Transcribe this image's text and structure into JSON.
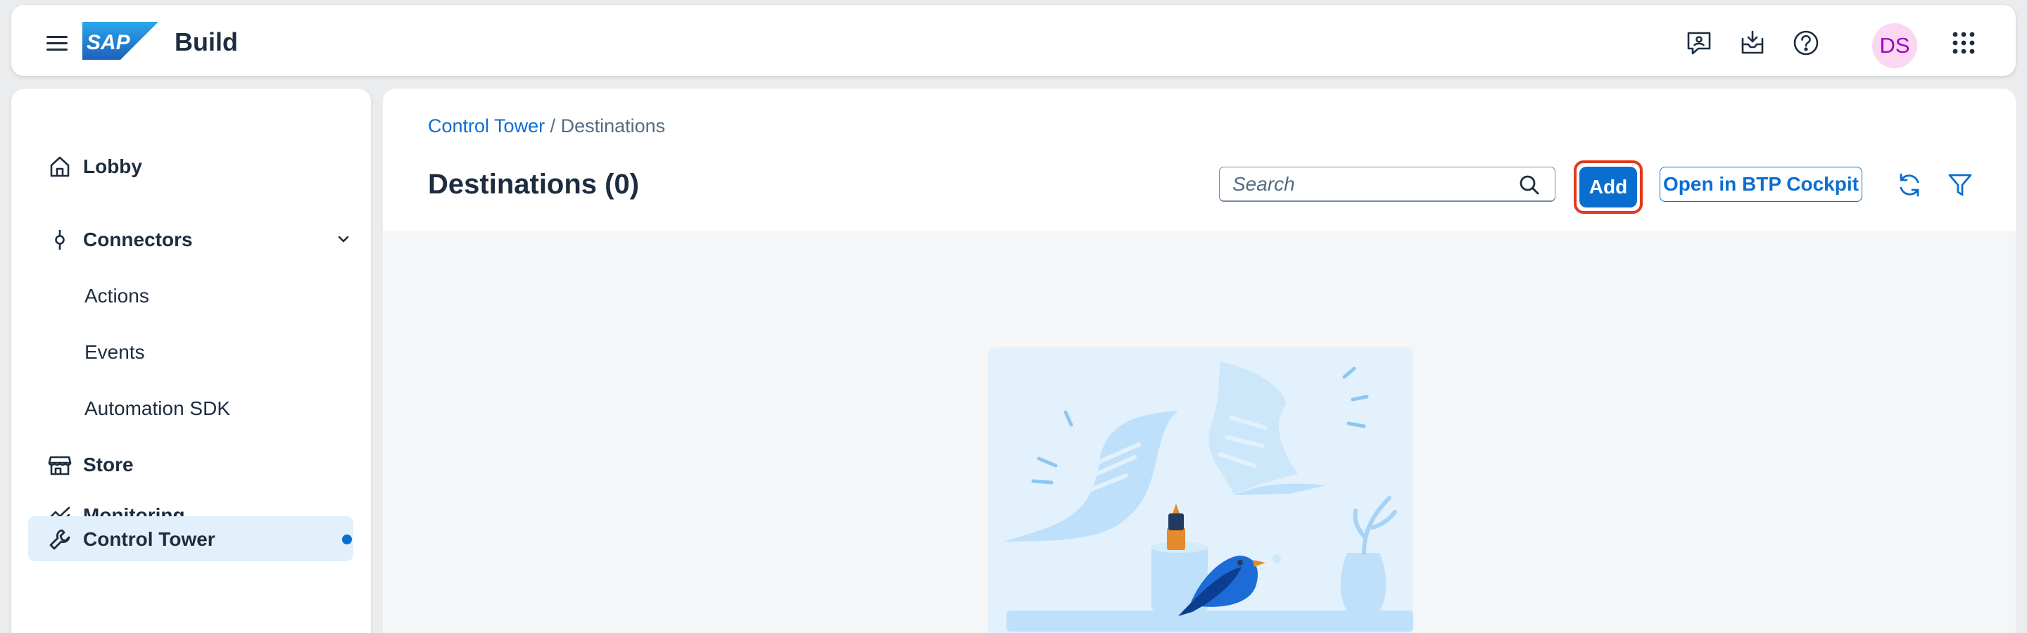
{
  "shell": {
    "logo_text": "SAP",
    "product_name": "Build",
    "avatar_initials": "DS",
    "icons": [
      "menu-icon",
      "feedback-icon",
      "notifications-icon",
      "help-icon",
      "avatar",
      "product-switch-icon"
    ]
  },
  "sidebar": {
    "items": [
      {
        "label": "Lobby",
        "icon": "home-icon"
      },
      {
        "label": "Connectors",
        "icon": "connector-icon",
        "expanded": true
      },
      {
        "label": "Actions"
      },
      {
        "label": "Events"
      },
      {
        "label": "Automation SDK"
      },
      {
        "label": "Store",
        "icon": "store-icon"
      },
      {
        "label": "Monitoring",
        "icon": "monitoring-icon"
      },
      {
        "label": "Control Tower",
        "icon": "wrench-icon",
        "selected": true
      }
    ]
  },
  "main": {
    "breadcrumb": {
      "link": "Control Tower",
      "separator": " / ",
      "current": "Destinations"
    },
    "title": "Destinations (0)",
    "search": {
      "placeholder": "Search",
      "value": ""
    },
    "add_label": "Add",
    "open_btp_label": "Open in BTP Cockpit",
    "toolbar_icons": [
      "refresh-icon",
      "filter-icon"
    ]
  },
  "colors": {
    "accent": "#0a6ed1",
    "highlight": "#e03a1e",
    "selected_bg": "#e1f0fb",
    "avatar_bg": "#fbd7f2",
    "avatar_text": "#a100c2"
  }
}
